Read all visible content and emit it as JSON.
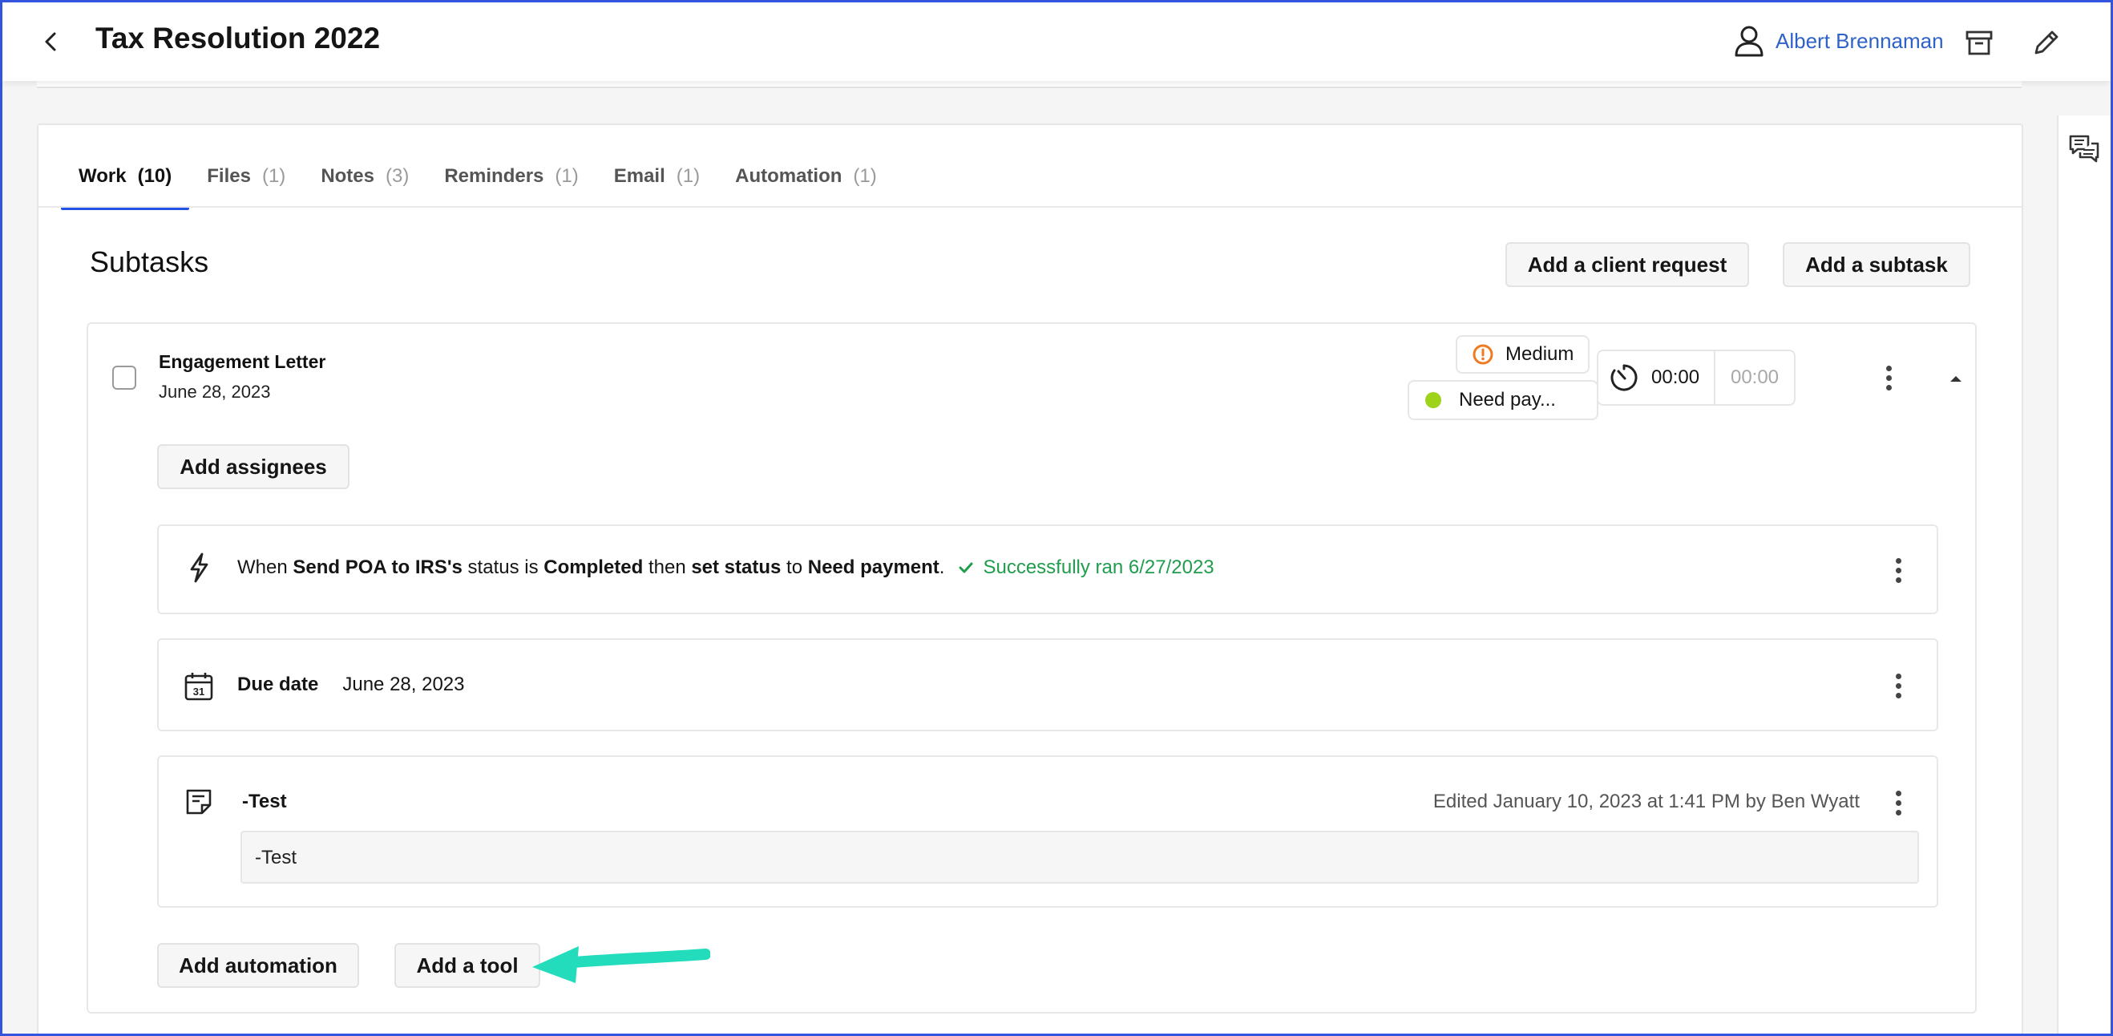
{
  "header": {
    "title": "Tax Resolution 2022",
    "user_name": "Albert Brennaman"
  },
  "tabs": [
    {
      "label": "Work",
      "count": "(10)"
    },
    {
      "label": "Files",
      "count": "(1)"
    },
    {
      "label": "Notes",
      "count": "(3)"
    },
    {
      "label": "Reminders",
      "count": "(1)"
    },
    {
      "label": "Email",
      "count": "(1)"
    },
    {
      "label": "Automation",
      "count": "(1)"
    }
  ],
  "section": {
    "title": "Subtasks",
    "add_client_request": "Add a client request",
    "add_subtask": "Add a subtask"
  },
  "subtask": {
    "name": "Engagement Letter",
    "date": "June 28, 2023",
    "priority": "Medium",
    "status": "Need pay...",
    "timer_elapsed": "00:00",
    "timer_estimate": "00:00",
    "add_assignees": "Add assignees",
    "automation": {
      "p1": "When ",
      "b1": "Send POA to IRS's",
      "p2": " status is ",
      "b2": "Completed",
      "p3": " then ",
      "b3": "set status",
      "p4": " to ",
      "b4": "Need payment",
      "p5": ".",
      "success": "Successfully ran 6/27/2023"
    },
    "due": {
      "label": "Due date",
      "value": "June 28, 2023"
    },
    "note": {
      "title": "-Test",
      "edited": "Edited January 10, 2023 at 1:41 PM by Ben Wyatt",
      "body": "-Test"
    },
    "add_automation": "Add automation",
    "add_tool": "Add a tool"
  },
  "colors": {
    "accent": "#2353e6",
    "link": "#2f62c8",
    "success": "#1f9d4c",
    "priority_medium": "#f07a1f",
    "status_dot": "#9dd31a",
    "arrow": "#22dcbc"
  }
}
